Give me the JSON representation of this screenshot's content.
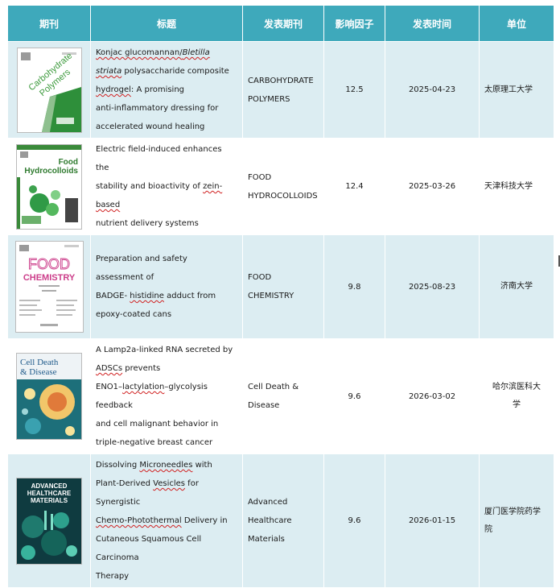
{
  "headers": {
    "cover": "期刊",
    "title": "标题",
    "journal": "发表期刊",
    "impact": "影响因子",
    "date": "发表时间",
    "unit": "单位"
  },
  "rows": [
    {
      "cover_name": "carbohydrate-polymers-cover",
      "cover_text": {
        "line1": "Carbohydrate",
        "line2": "Polymers"
      },
      "title": {
        "p1": "Konjac glucomannan/",
        "p2": "Bletilla",
        "p3": "striata",
        "p4": " polysaccharide composite",
        "p5": "hydrogel",
        "p6": ": A promising",
        "p7": "anti-inflammatory dressing for",
        "p8": "accelerated wound healing"
      },
      "journal": {
        "l1": "CARBOHYDRATE",
        "l2": "POLYMERS"
      },
      "impact": "12.5",
      "date": "2025-04-23",
      "unit": "太原理工大学"
    },
    {
      "cover_name": "food-hydrocolloids-cover",
      "cover_text": {
        "line1": "Food",
        "line2": "Hydrocolloids"
      },
      "title": {
        "p1": "Electric field-induced enhances the",
        "p2": "stability and bioactivity of ",
        "p3": "zein-based",
        "p4": "nutrient delivery systems"
      },
      "journal": {
        "l1": "FOOD",
        "l2": "HYDROCOLLOIDS"
      },
      "impact": "12.4",
      "date": "2025-03-26",
      "unit": "天津科技大学"
    },
    {
      "cover_name": "food-chemistry-cover",
      "cover_text": {
        "line1": "FOOD",
        "line2": "CHEMISTRY"
      },
      "title": {
        "p1": "Preparation and safety assessment of",
        "p2": "BADGE- ",
        "p3": "histidine",
        "p4": " adduct from",
        "p5": "epoxy-coated cans"
      },
      "journal": {
        "l1": "FOOD",
        "l2": "CHEMISTRY"
      },
      "impact": "9.8",
      "date": "2025-08-23",
      "unit": "济南大学"
    },
    {
      "cover_name": "cell-death-disease-cover",
      "cover_text": {
        "line1": "Cell Death",
        "line2": "& Disease"
      },
      "title": {
        "p1": "A Lamp2a-linked RNA secreted by",
        "p2": "ADSCs",
        "p3": " prevents",
        "p4": "ENO1–",
        "p5": "lactylation",
        "p6": "–glycolysis feedback",
        "p7": "and cell malignant behavior in",
        "p8": "triple-negative breast cancer"
      },
      "journal": {
        "l1": "Cell Death &",
        "l2": "Disease"
      },
      "impact": "9.6",
      "date": "2026-03-02",
      "unit_l1": "哈尔滨医科大",
      "unit_l2": "学"
    },
    {
      "cover_name": "advanced-healthcare-materials-cover",
      "cover_text": {
        "line1": "ADVANCED",
        "line2": "HEALTHCARE",
        "line3": "MATERIALS"
      },
      "title": {
        "p1": "Dissolving ",
        "p2": "Microneedles",
        "p3": " with",
        "p4": "Plant-Derived ",
        "p5": "Vesicles",
        "p6": " for Synergistic",
        "p7": "Chemo-Photothermal",
        "p8": " Delivery in",
        "p9": "Cutaneous Squamous Cell Carcinoma",
        "p10": "Therapy"
      },
      "journal": {
        "l1": "Advanced",
        "l2": "Healthcare",
        "l3": "Materials"
      },
      "impact": "9.6",
      "date": "2026-01-15",
      "unit_l1": "厦门医学院药学",
      "unit_l2": "院"
    }
  ],
  "colors": {
    "header_bg": "#3ea9bb",
    "row_bg": "#dcedf2",
    "row_alt_bg": "#ffffff",
    "spellcheck": "#d02020"
  }
}
